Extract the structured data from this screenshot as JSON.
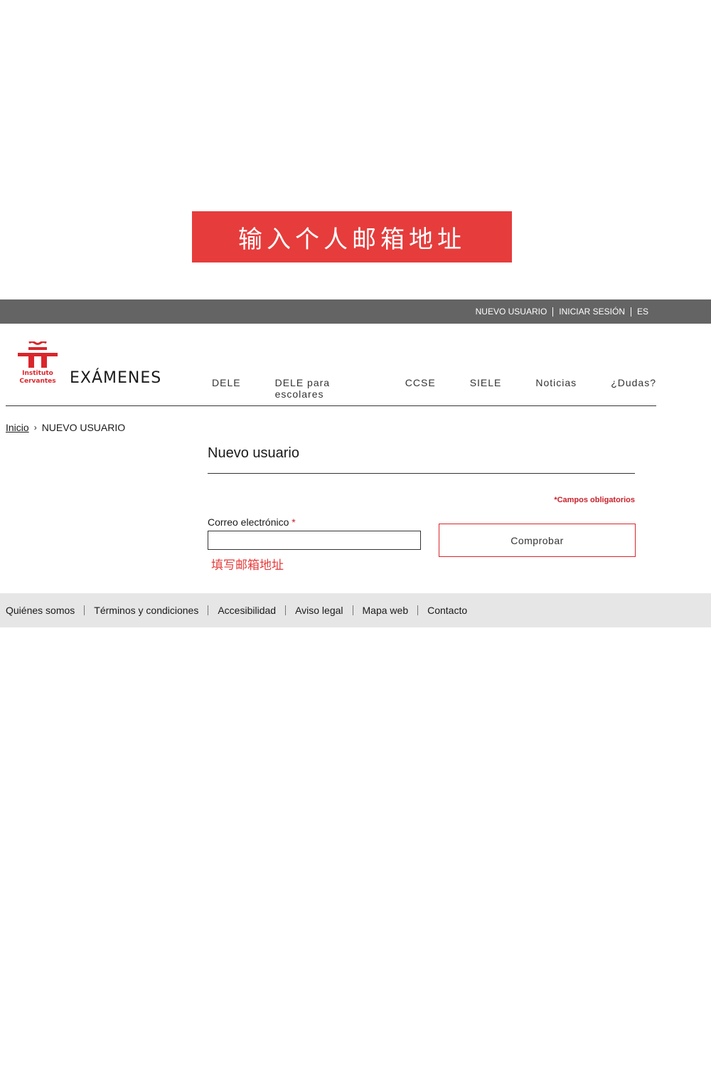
{
  "banner": {
    "text": "输入个人邮箱地址"
  },
  "utility": {
    "links": [
      "NUEVO USUARIO",
      "INICIAR SESIÓN",
      "ES"
    ]
  },
  "header": {
    "logo_line1": "Instituto",
    "logo_line2": "Cervantes",
    "brand": "EXÁMENES",
    "logo_color": "#d9262c",
    "nav": [
      "DELE",
      "DELE para escolares",
      "CCSE",
      "SIELE",
      "Noticias",
      "¿Dudas?"
    ]
  },
  "breadcrumb": {
    "home": "Inicio",
    "separator": "›",
    "current": "NUEVO USUARIO"
  },
  "form": {
    "title": "Nuevo usuario",
    "required_note": "*Campos obligatorios",
    "email_label": "Correo electrónico",
    "required_star": "*",
    "email_value": "",
    "check_button": "Comprobar",
    "hint": "填写邮箱地址"
  },
  "footer": {
    "links": [
      "Quiénes somos",
      "Términos y condiciones",
      "Accesibilidad",
      "Aviso legal",
      "Mapa web",
      "Contacto"
    ]
  },
  "colors": {
    "accent_red": "#e63c3c",
    "brand_red": "#d9262c",
    "utility_bar": "#646464",
    "footer_bg": "#e6e6e6"
  }
}
